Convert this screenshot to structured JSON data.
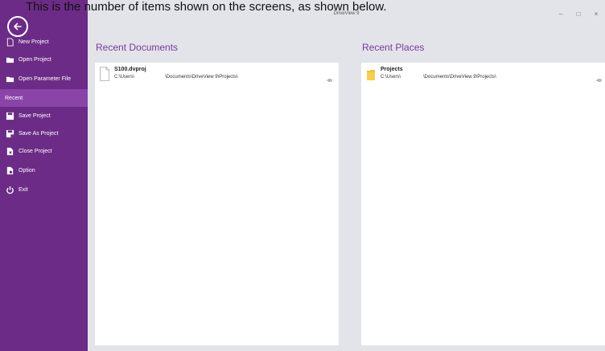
{
  "caption": "This is the number of items shown on the screens, as shown below.",
  "window": {
    "title": "DriveView 9",
    "minimize": "–",
    "maximize": "□",
    "close": "×"
  },
  "sidebar": {
    "items": [
      {
        "label": "New Project",
        "icon": "new-file-icon"
      },
      {
        "label": "Open Project",
        "icon": "folder-open-icon"
      },
      {
        "label": "Open Parameter File",
        "icon": "folder-open-icon"
      },
      {
        "label": "Recent",
        "icon": "",
        "active": true
      },
      {
        "label": "Save Project",
        "icon": "save-icon"
      },
      {
        "label": "Save As Project",
        "icon": "save-as-icon"
      },
      {
        "label": "Close Project",
        "icon": "close-file-icon"
      },
      {
        "label": "Option",
        "icon": "option-icon"
      },
      {
        "label": "Exit",
        "icon": "power-icon"
      }
    ]
  },
  "recent_documents": {
    "title": "Recent Documents",
    "items": [
      {
        "name": "S100.dvproj",
        "path_start": "C:\\Users\\",
        "path_end": "\\Documents\\DriveView 9\\Projects\\"
      }
    ]
  },
  "recent_places": {
    "title": "Recent Places",
    "items": [
      {
        "name": "Projects",
        "path_start": "C:\\Users\\",
        "path_end": "\\Documents\\DriveView 9\\Projects\\"
      }
    ]
  },
  "colors": {
    "sidebar": "#6b2b86",
    "sidebar_active": "#8a44a8",
    "accent_text": "#7a3a98",
    "background": "#e3e3ea",
    "folder": "#f0c23b"
  }
}
